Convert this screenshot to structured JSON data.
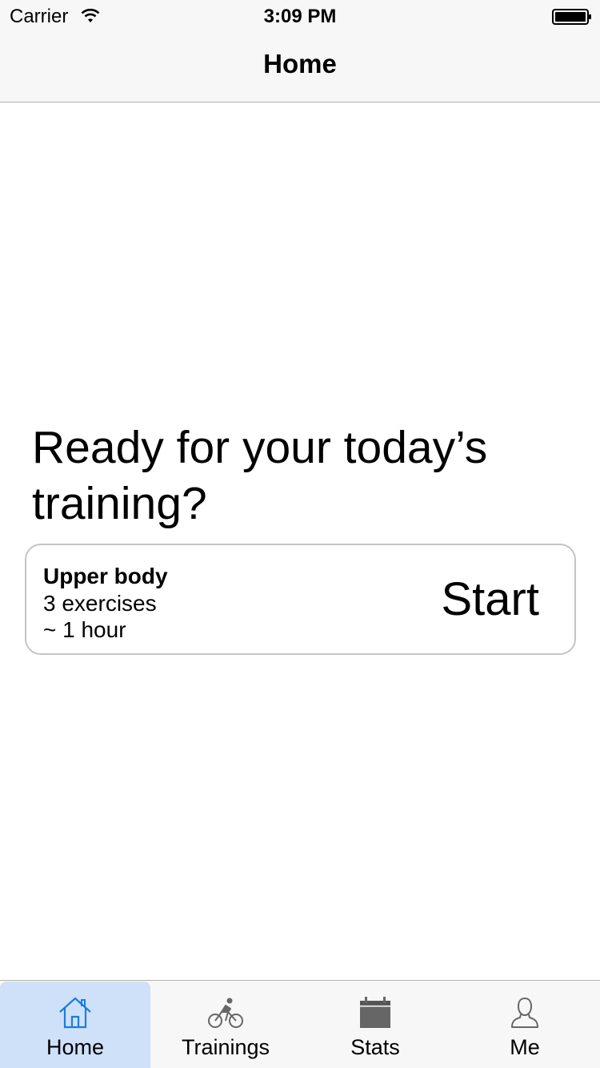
{
  "status_bar": {
    "carrier": "Carrier",
    "time": "3:09 PM",
    "wifi_icon": "wifi-icon",
    "battery_icon": "battery-full-icon"
  },
  "nav": {
    "title": "Home"
  },
  "main": {
    "prompt": "Ready for your today’s training?",
    "card": {
      "title": "Upper body",
      "exercises": "3 exercises",
      "duration": "~ 1 hour",
      "start_label": "Start"
    }
  },
  "tab_bar": {
    "active_color": "#cfe1f8",
    "active_icon_color": "#1a7de0",
    "inactive_icon_color": "#666666",
    "tabs": [
      {
        "label": "Home",
        "icon": "home-icon",
        "active": true
      },
      {
        "label": "Trainings",
        "icon": "bicycle-icon",
        "active": false
      },
      {
        "label": "Stats",
        "icon": "calendar-icon",
        "active": false
      },
      {
        "label": "Me",
        "icon": "person-icon",
        "active": false
      }
    ]
  }
}
